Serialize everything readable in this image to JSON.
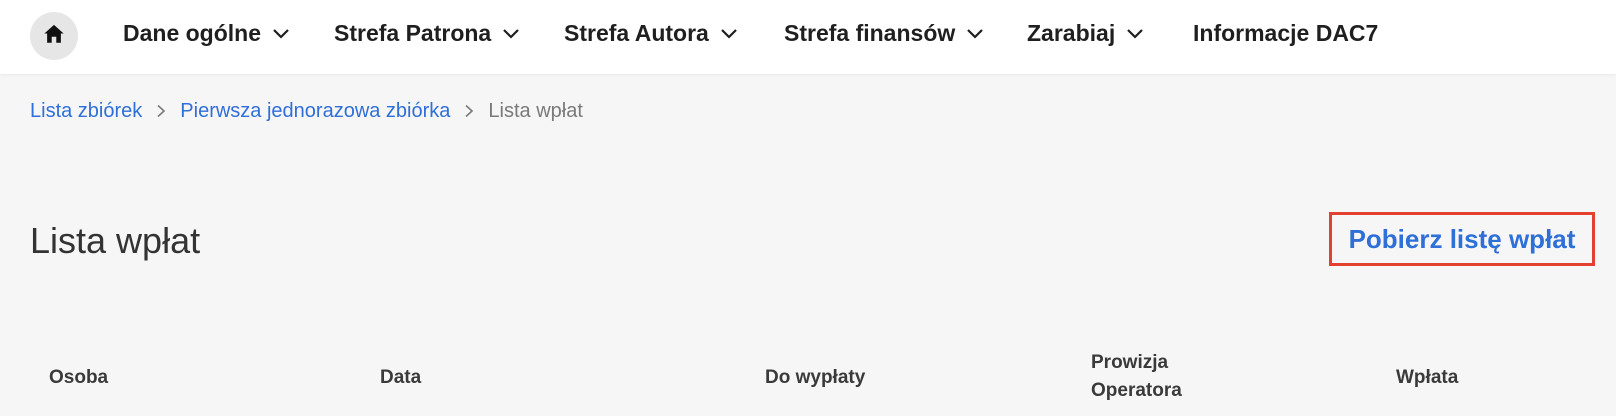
{
  "nav": {
    "home_icon": "home-icon",
    "items": [
      {
        "label": "Dane ogólne",
        "has_dropdown": true
      },
      {
        "label": "Strefa Patrona",
        "has_dropdown": true
      },
      {
        "label": "Strefa Autora",
        "has_dropdown": true
      },
      {
        "label": "Strefa finansów",
        "has_dropdown": true
      },
      {
        "label": "Zarabiaj",
        "has_dropdown": true
      },
      {
        "label": "Informacje DAC7",
        "has_dropdown": false
      }
    ]
  },
  "breadcrumb": {
    "items": [
      {
        "label": "Lista zbiórek"
      },
      {
        "label": "Pierwsza jednorazowa zbiórka"
      }
    ],
    "current": "Lista wpłat"
  },
  "page": {
    "title": "Lista wpłat",
    "download_label": "Pobierz listę wpłat"
  },
  "table": {
    "headers": [
      {
        "line1": "Osoba",
        "line2": ""
      },
      {
        "line1": "Data",
        "line2": ""
      },
      {
        "line1": "Do wypłaty",
        "line2": ""
      },
      {
        "line1": "Prowizja",
        "line2": "Operatora"
      },
      {
        "line1": "Wpłata",
        "line2": ""
      }
    ]
  },
  "colors": {
    "link": "#2f6fd8",
    "highlight_border": "#e4402f",
    "background": "#f6f6f6",
    "topbar": "#ffffff"
  }
}
